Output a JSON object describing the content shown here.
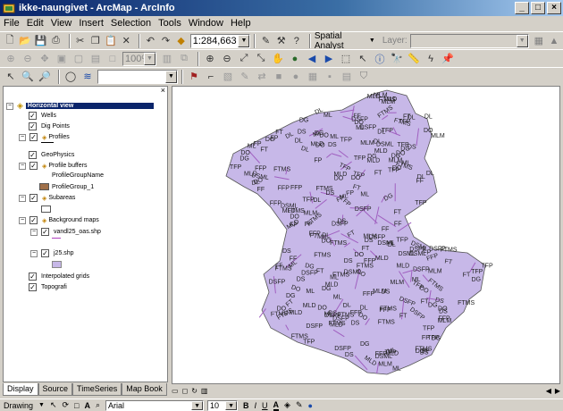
{
  "window": {
    "title": "ikke-naungivet - ArcMap - ArcInfo"
  },
  "menu": [
    "File",
    "Edit",
    "View",
    "Insert",
    "Selection",
    "Tools",
    "Window",
    "Help"
  ],
  "toolbar": {
    "scale_value": "1:284,663",
    "spatial_analyst_label": "Spatial Analyst",
    "layer_label": "Layer:",
    "zoom_value": "100%"
  },
  "toc": {
    "dataframe": "Horizontal view",
    "items": {
      "wells": "Wells",
      "dig_points": "Dig Points",
      "profiles": "Profiles",
      "geophysics": "GeoPhysics",
      "profile_buffers": "Profile buffers",
      "profile_group_name": "ProfileGroupName",
      "profile_group_1": "ProfileGroup_1",
      "subareas": "Subareas",
      "background_maps": "Background maps",
      "vandl25": "vandl25_oas.shp",
      "j25": "j25.shp",
      "interpolated_grids": "Interpolated grids",
      "topografi": "Topografi"
    }
  },
  "tabs": [
    "Display",
    "Source",
    "TimeSeries",
    "Map Book"
  ],
  "drawing": {
    "label": "Drawing",
    "font": "Arial",
    "font_size": "10",
    "bold": "B",
    "italic": "I",
    "underline": "U",
    "text_color": "A"
  },
  "map_labels": [
    "FP",
    "DS",
    "FT",
    "ML",
    "DL",
    "DG",
    "FF",
    "DO",
    "FFP",
    "MLD",
    "TFP",
    "DSFP",
    "FTMS",
    "DSML",
    "MLM"
  ],
  "colors": {
    "region_fill": "#c7b8e8",
    "region_line": "#a060c0",
    "label": "#222"
  }
}
